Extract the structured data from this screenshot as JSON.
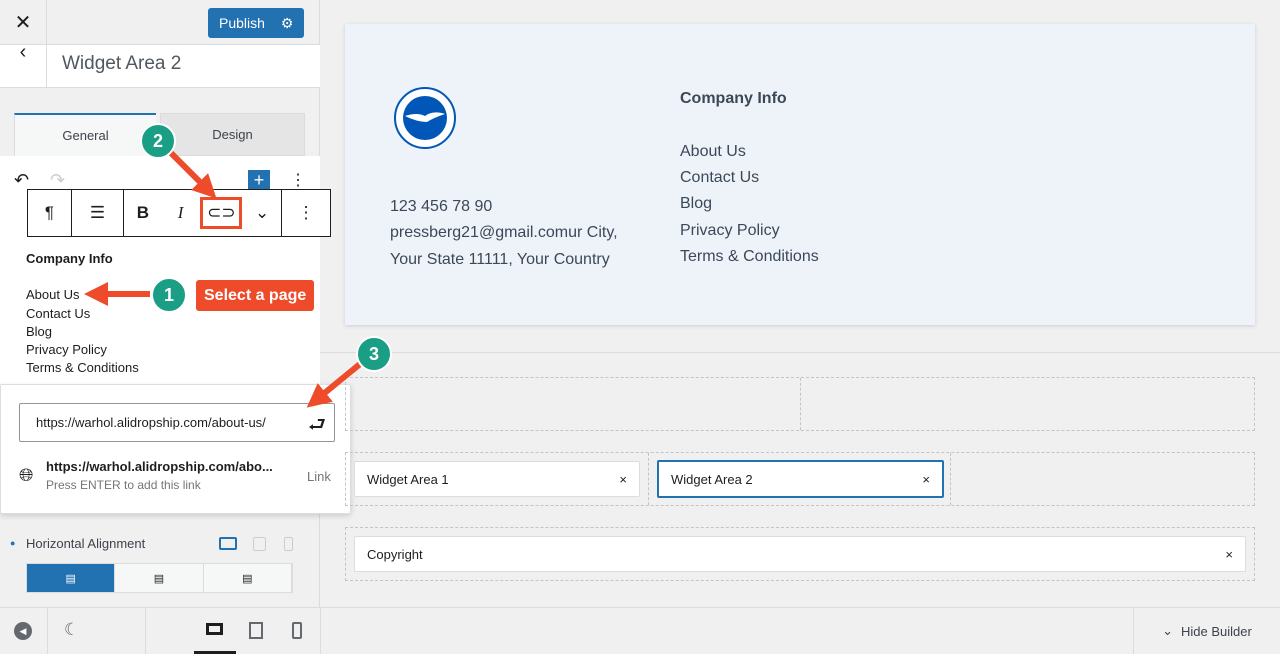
{
  "sidebar": {
    "publish": "Publish",
    "title": "Widget Area 2",
    "tabs": [
      "General",
      "Design"
    ],
    "content": {
      "heading": "Company Info",
      "links": [
        "About Us",
        "Contact Us",
        "Blog",
        "Privacy Policy",
        "Terms & Conditions"
      ]
    },
    "link_popover": {
      "url": "https://warhol.alidropship.com/about-us/",
      "suggestion": "https://warhol.alidropship.com/abo...",
      "hint": "Press ENTER to add this link",
      "type": "Link"
    },
    "horizontal_alignment": "Horizontal Alignment"
  },
  "preview": {
    "phone": "123 456 78 90",
    "address1": "pressberg21@gmail.comur City,",
    "address2": "Your State 11111, Your Country",
    "heading": "Company Info",
    "links": [
      "About Us",
      "Contact Us",
      "Blog",
      "Privacy Policy",
      "Terms & Conditions"
    ],
    "logo_text": "BRIGHTON & HOVE ALBION"
  },
  "builder": {
    "widgets": [
      "Widget Area 1",
      "Widget Area 2"
    ],
    "copyright": "Copyright",
    "hide": "Hide Builder"
  },
  "annotations": {
    "step1": "1",
    "step2": "2",
    "step3": "3",
    "callout": "Select a page"
  },
  "colors": {
    "accent": "#2271b1",
    "annotation_red": "#ee4b2b",
    "annotation_green": "#1a9e85"
  }
}
